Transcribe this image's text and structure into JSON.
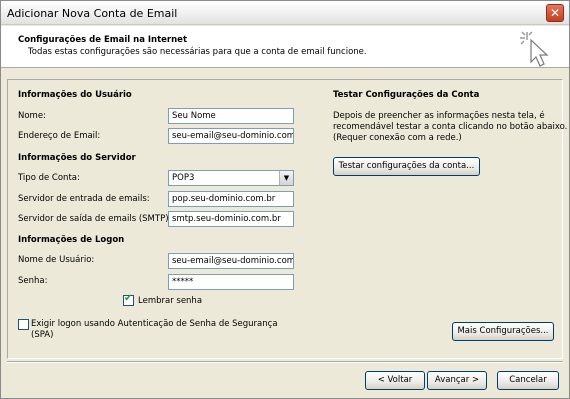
{
  "window": {
    "title": "Adicionar Nova Conta de Email"
  },
  "header": {
    "title": "Configurações de Email na Internet",
    "subtitle": "Todas estas configurações são necessárias para que a conta de email funcione."
  },
  "user_info": {
    "section_title": "Informações do Usuário",
    "name_label": "Nome:",
    "name_value": "Seu Nome",
    "email_label": "Endereço de Email:",
    "email_value": "seu-email@seu-dominio.com.br"
  },
  "server_info": {
    "section_title": "Informações do Servidor",
    "account_type_label": "Tipo de Conta:",
    "account_type_value": "POP3",
    "incoming_label": "Servidor de entrada de emails:",
    "incoming_value": "pop.seu-dominio.com.br",
    "outgoing_label": "Servidor de saída de emails (SMTP):",
    "outgoing_value": "smtp.seu-dominio.com.br"
  },
  "logon_info": {
    "section_title": "Informações de Logon",
    "username_label": "Nome de Usuário:",
    "username_value": "seu-email@seu-dominio.com.br",
    "password_label": "Senha:",
    "password_value": "*****",
    "remember_label": "Lembrar senha",
    "remember_checked": true,
    "spa_label_line1": "Exigir logon usando Autenticação de Senha de Segurança",
    "spa_label_line2": "(SPA)",
    "spa_checked": false
  },
  "test": {
    "section_title": "Testar Configurações da Conta",
    "description_line1": "Depois de preencher as informações nesta tela, é",
    "description_line2": "recomendável testar a conta clicando no botão abaixo.",
    "description_line3": "(Requer conexão com a rede.)",
    "test_button": "Testar configurações da conta..."
  },
  "buttons": {
    "more_settings": "Mais Configurações...",
    "back": "< Voltar",
    "next": "Avançar >",
    "cancel": "Cancelar"
  }
}
